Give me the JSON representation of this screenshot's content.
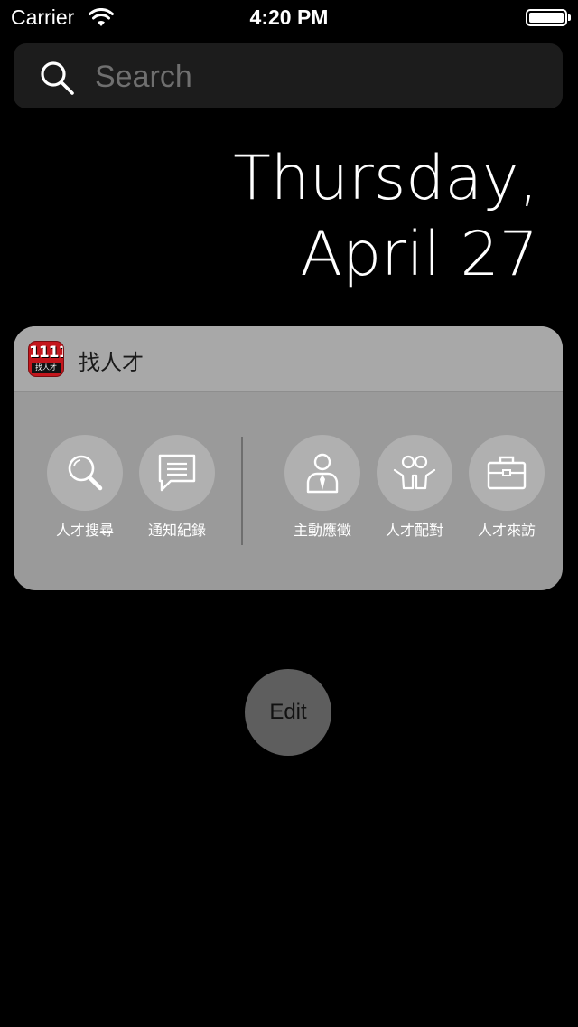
{
  "status_bar": {
    "carrier": "Carrier",
    "time": "4:20 PM",
    "battery_level": 1.0
  },
  "search": {
    "placeholder": "Search"
  },
  "date": {
    "line1": "Thursday,",
    "line2": "April 27"
  },
  "widget": {
    "title": "找人才",
    "app_icon": {
      "number": "1111",
      "sub": "找人才"
    },
    "actions": [
      {
        "label": "人才搜尋",
        "icon": "magnifier-icon"
      },
      {
        "label": "通知紀錄",
        "icon": "message-icon"
      },
      {
        "label": "主動應徵",
        "icon": "person-tie-icon"
      },
      {
        "label": "人才配對",
        "icon": "people-pair-icon"
      },
      {
        "label": "人才來訪",
        "icon": "briefcase-icon"
      }
    ]
  },
  "edit_button": {
    "label": "Edit"
  },
  "colors": {
    "background": "#000000",
    "widget_body": "#9a9a9a",
    "widget_header": "#a8a8a8",
    "app_icon_red": "#c4161c"
  }
}
